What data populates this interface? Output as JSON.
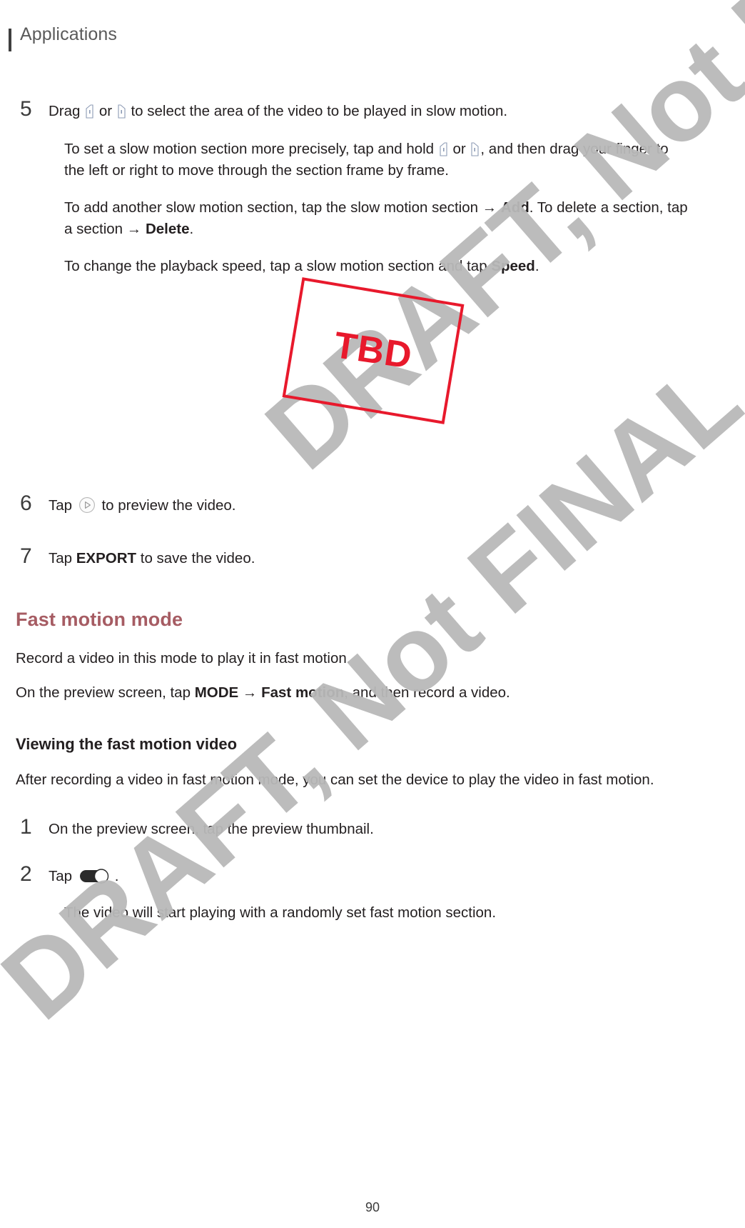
{
  "header": {
    "title": "Applications"
  },
  "steps_top": [
    {
      "number": "5",
      "text_before": "Drag ",
      "text_mid": " or ",
      "text_after": " to select the area of the video to be played in slow motion.",
      "icon_left": "slow-motion-handle-left-icon",
      "icon_right": "slow-motion-handle-right-icon"
    }
  ],
  "paragraphs": {
    "precise": {
      "part1": "To set a slow motion section more precisely, tap and hold ",
      "part2": " or ",
      "part3": ", and then drag your finger to the left or right to move through the section frame by frame."
    },
    "add_delete": {
      "part1": "To add another slow motion section, tap the slow motion section ",
      "arrow1": "→",
      "bold1": "Add",
      "part2": ". To delete a section, tap a section ",
      "arrow2": "→",
      "bold2": "Delete",
      "part3": "."
    },
    "speed": {
      "part1": "To change the playback speed, tap a slow motion section and tap ",
      "bold1": "Speed",
      "part2": "."
    }
  },
  "tbd": {
    "label": "TBD",
    "border_color": "#e8192c",
    "text_color": "#e8192c"
  },
  "steps_bottom": [
    {
      "number": "6",
      "text_before": "Tap ",
      "text_after": " to preview the video.",
      "icon": "play-circle-icon"
    },
    {
      "number": "7",
      "text_before": "Tap ",
      "bold": "EXPORT",
      "text_after": " to save the video."
    }
  ],
  "fast_motion": {
    "heading": "Fast motion mode",
    "heading_color": "#a65c63",
    "intro": "Record a video in this mode to play it in fast motion.",
    "instruction": {
      "part1": "On the preview screen, tap ",
      "bold1": "MODE",
      "arrow": "→",
      "bold2": "Fast motion",
      "part2": ", and then record a video."
    }
  },
  "viewing": {
    "heading": "Viewing the fast motion video",
    "intro": "After recording a video in fast motion mode, you can set the device to play the video in fast motion.",
    "steps": [
      {
        "number": "1",
        "text": "On the preview screen, tap the preview thumbnail."
      },
      {
        "number": "2",
        "text_before": "Tap ",
        "text_after": ".",
        "icon": "fast-motion-toggle-icon"
      }
    ],
    "note": "The video will start playing with a randomly set fast motion section."
  },
  "watermark": {
    "line1": "DRAFT, Not FINAL",
    "color": "#b9b9b9"
  },
  "footer": {
    "page_number": "90"
  }
}
